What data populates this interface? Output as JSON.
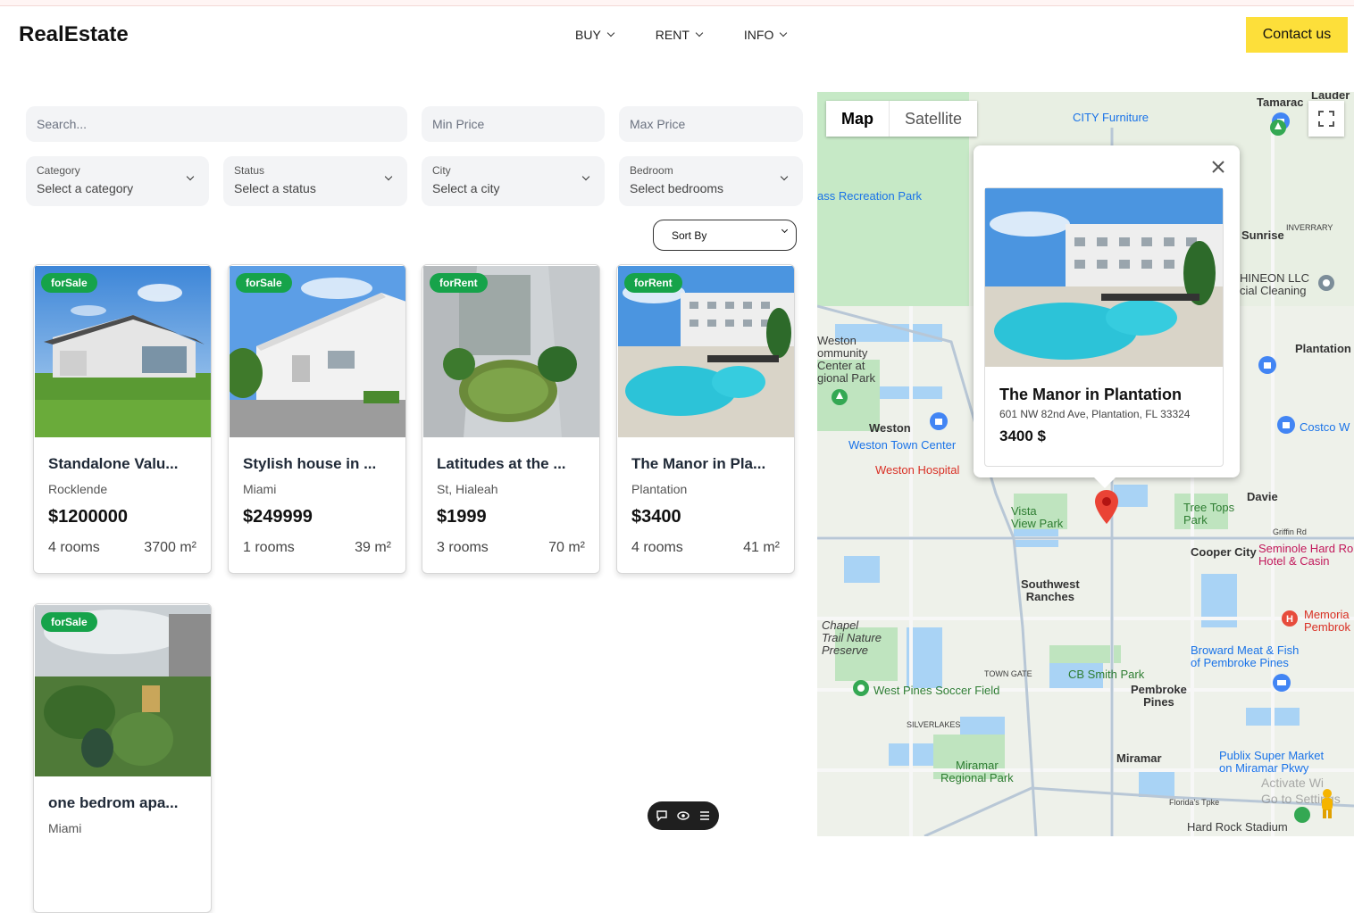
{
  "header": {
    "logo": "RealEstate",
    "nav": [
      {
        "label": "BUY"
      },
      {
        "label": "RENT"
      },
      {
        "label": "INFO"
      }
    ],
    "contact_label": "Contact us"
  },
  "filters": {
    "search_placeholder": "Search...",
    "min_price_placeholder": "Min Price",
    "max_price_placeholder": "Max Price",
    "selects": [
      {
        "label": "Category",
        "value": "Select a category"
      },
      {
        "label": "Status",
        "value": "Select a status"
      },
      {
        "label": "City",
        "value": "Select a city"
      },
      {
        "label": "Bedroom",
        "value": "Select bedrooms"
      }
    ],
    "sort_label": "Sort By"
  },
  "listings": [
    {
      "badge": "forSale",
      "title": "Standalone Valu...",
      "location": "Rocklende",
      "price": "$1200000",
      "rooms": "4 rooms",
      "area": "3700 m²"
    },
    {
      "badge": "forSale",
      "title": "Stylish house in ...",
      "location": "Miami",
      "price": "$249999",
      "rooms": "1 rooms",
      "area": "39 m²"
    },
    {
      "badge": "forRent",
      "title": "Latitudes at the ...",
      "location": "St, Hialeah",
      "price": "$1999",
      "rooms": "3 rooms",
      "area": "70 m²"
    },
    {
      "badge": "forRent",
      "title": "The Manor in Pla...",
      "location": "Plantation",
      "price": "$3400",
      "rooms": "4 rooms",
      "area": "41 m²"
    },
    {
      "badge": "forSale",
      "title": "one bedrom apa...",
      "location": "Miami",
      "price": "",
      "rooms": "",
      "area": ""
    }
  ],
  "map": {
    "toggle": {
      "map": "Map",
      "satellite": "Satellite"
    },
    "infowindow": {
      "title": "The Manor in Plantation",
      "address": "601 NW 82nd Ave, Plantation, FL 33324",
      "price": "3400 $"
    },
    "labels": {
      "tamarac": "Tamarac",
      "lauderdale": "Lauder",
      "city_furniture": "CITY Furniture",
      "recreation_park": "ass Recreation Park",
      "sunrise": "Sunrise",
      "inverrary": "INVERRARY",
      "shineon": "HINEON LLC",
      "cleaning": "cial Cleaning",
      "plantation": "Plantation",
      "weston_center": "Weston\nommunity\nCenter at\ngional Park",
      "weston": "Weston",
      "weston_town": "Weston Town Center",
      "weston_hospital": "Weston Hospital",
      "costco": "Costco W",
      "davie": "Davie",
      "vista": "Vista\nView Park",
      "tree_tops": "Tree Tops\nPark",
      "griffin": "Griffin Rd",
      "cooper_city": "Cooper City",
      "seminole": "Seminole Hard Ro\nHotel & Casin",
      "sw_ranches": "Southwest\nRanches",
      "chapel_trail": "Chapel\nTrail Nature\nPreserve",
      "memorial": "Memoria\nPembrok",
      "broward_meat": "Broward Meat & Fish\nof Pembroke Pines",
      "town_gate": "TOWN GATE",
      "cb_smith": "CB Smith Park",
      "west_pines": "West Pines Soccer Field",
      "pembroke_pines": "Pembroke\nPines",
      "silverlakes": "SILVERLAKES",
      "miramar": "Miramar",
      "miramar_park": "Miramar\nRegional Park",
      "publix": "Publix Super Market\non Miramar Pkwy",
      "floridas_tpke": "Florida's Tpke",
      "hard_rock": "Hard Rock Stadium",
      "activate": "Activate Wi\nGo to Settings"
    }
  },
  "colors": {
    "badge": "#16a34a",
    "contact": "#fddf3a",
    "input_bg": "#f3f4f6",
    "map_land": "#e8efe3",
    "map_park": "#c5e8c5",
    "map_water": "#a8d4f5",
    "marker": "#ea4335"
  },
  "toolbar": {
    "icons": [
      "chat-icon",
      "eye-icon",
      "list-icon"
    ]
  }
}
